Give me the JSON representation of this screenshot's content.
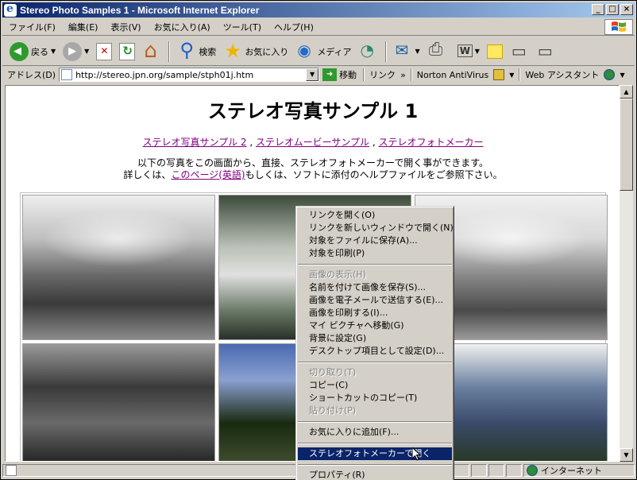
{
  "window": {
    "title": "Stereo Photo Samples 1 - Microsoft Internet Explorer",
    "controls": [
      "_",
      "□",
      "×"
    ]
  },
  "menubar": {
    "items": [
      "ファイル(F)",
      "編集(E)",
      "表示(V)",
      "お気に入り(A)",
      "ツール(T)",
      "ヘルプ(H)"
    ]
  },
  "toolbar": {
    "back_label": "戻る",
    "search_label": "検索",
    "favorites_label": "お気に入り",
    "media_label": "メディア"
  },
  "address": {
    "label": "アドレス(D)",
    "url": "http://stereo.jpn.org/sample/stph01j.htm",
    "go_label": "移動",
    "links_label": "リンク",
    "links_chevron": "»",
    "norton_label": "Norton AntiVirus",
    "web_assistant_label": "Web アシスタント"
  },
  "page": {
    "title": "ステレオ写真サンプル 1",
    "nav_links": [
      "ステレオ写真サンプル 2",
      "ステレオムービーサンプル",
      "ステレオフォトメーカー"
    ],
    "nav_separator": ",",
    "intro_line1": "以下の写真をこの画面から、直接、ステレオフォトメーカーで開く事ができます。",
    "intro_line2_prefix": "詳しくは、",
    "intro_link": "このページ(英語)",
    "intro_line2_suffix": "もしくは、ソフトに添付のヘルプファイルをご参照下さい。"
  },
  "context_menu": {
    "items": [
      {
        "label": "リンクを開く(O)",
        "disabled": false
      },
      {
        "label": "リンクを新しいウィンドウで開く(N)",
        "disabled": false
      },
      {
        "label": "対象をファイルに保存(A)...",
        "disabled": false
      },
      {
        "label": "対象を印刷(P)",
        "disabled": false
      },
      {
        "separator": true
      },
      {
        "label": "画像の表示(H)",
        "disabled": true
      },
      {
        "label": "名前を付けて画像を保存(S)...",
        "disabled": false
      },
      {
        "label": "画像を電子メールで送信する(E)...",
        "disabled": false
      },
      {
        "label": "画像を印刷する(I)...",
        "disabled": false
      },
      {
        "label": "マイ ピクチャへ移動(G)",
        "disabled": false
      },
      {
        "label": "背景に設定(G)",
        "disabled": false
      },
      {
        "label": "デスクトップ項目として設定(D)...",
        "disabled": false
      },
      {
        "separator": true
      },
      {
        "label": "切り取り(T)",
        "disabled": true
      },
      {
        "label": "コピー(C)",
        "disabled": false
      },
      {
        "label": "ショートカットのコピー(T)",
        "disabled": false
      },
      {
        "label": "貼り付け(P)",
        "disabled": true
      },
      {
        "separator": true
      },
      {
        "label": "お気に入りに追加(F)...",
        "disabled": false
      },
      {
        "separator": true
      },
      {
        "label": "ステレオフォトメーカーで開く",
        "disabled": false,
        "highlighted": true
      },
      {
        "separator": true
      },
      {
        "label": "プロパティ(R)",
        "disabled": false
      }
    ]
  },
  "statusbar": {
    "zone_label": "インターネット"
  },
  "colors": {
    "title_bar": "#0a246a",
    "link_visited": "#800080",
    "menu_highlight": "#0a246a"
  }
}
